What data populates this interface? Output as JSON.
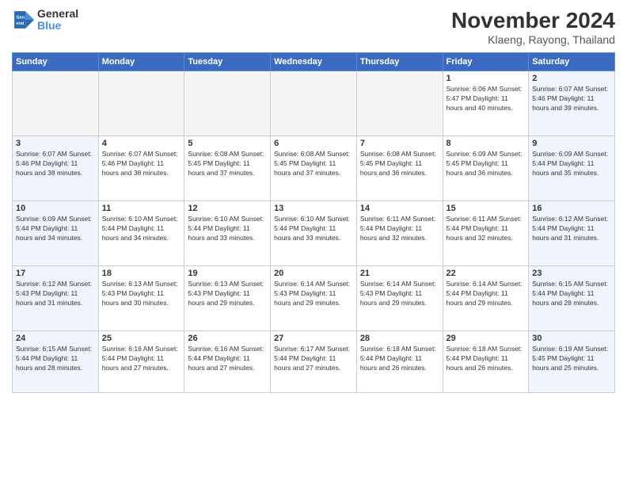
{
  "logo": {
    "line1": "General",
    "line2": "Blue"
  },
  "title": "November 2024",
  "location": "Klaeng, Rayong, Thailand",
  "weekdays": [
    "Sunday",
    "Monday",
    "Tuesday",
    "Wednesday",
    "Thursday",
    "Friday",
    "Saturday"
  ],
  "weeks": [
    [
      {
        "day": "",
        "info": ""
      },
      {
        "day": "",
        "info": ""
      },
      {
        "day": "",
        "info": ""
      },
      {
        "day": "",
        "info": ""
      },
      {
        "day": "",
        "info": ""
      },
      {
        "day": "1",
        "info": "Sunrise: 6:06 AM\nSunset: 5:47 PM\nDaylight: 11 hours\nand 40 minutes."
      },
      {
        "day": "2",
        "info": "Sunrise: 6:07 AM\nSunset: 5:46 PM\nDaylight: 11 hours\nand 39 minutes."
      }
    ],
    [
      {
        "day": "3",
        "info": "Sunrise: 6:07 AM\nSunset: 5:46 PM\nDaylight: 11 hours\nand 38 minutes."
      },
      {
        "day": "4",
        "info": "Sunrise: 6:07 AM\nSunset: 5:46 PM\nDaylight: 11 hours\nand 38 minutes."
      },
      {
        "day": "5",
        "info": "Sunrise: 6:08 AM\nSunset: 5:45 PM\nDaylight: 11 hours\nand 37 minutes."
      },
      {
        "day": "6",
        "info": "Sunrise: 6:08 AM\nSunset: 5:45 PM\nDaylight: 11 hours\nand 37 minutes."
      },
      {
        "day": "7",
        "info": "Sunrise: 6:08 AM\nSunset: 5:45 PM\nDaylight: 11 hours\nand 36 minutes."
      },
      {
        "day": "8",
        "info": "Sunrise: 6:09 AM\nSunset: 5:45 PM\nDaylight: 11 hours\nand 36 minutes."
      },
      {
        "day": "9",
        "info": "Sunrise: 6:09 AM\nSunset: 5:44 PM\nDaylight: 11 hours\nand 35 minutes."
      }
    ],
    [
      {
        "day": "10",
        "info": "Sunrise: 6:09 AM\nSunset: 5:44 PM\nDaylight: 11 hours\nand 34 minutes."
      },
      {
        "day": "11",
        "info": "Sunrise: 6:10 AM\nSunset: 5:44 PM\nDaylight: 11 hours\nand 34 minutes."
      },
      {
        "day": "12",
        "info": "Sunrise: 6:10 AM\nSunset: 5:44 PM\nDaylight: 11 hours\nand 33 minutes."
      },
      {
        "day": "13",
        "info": "Sunrise: 6:10 AM\nSunset: 5:44 PM\nDaylight: 11 hours\nand 33 minutes."
      },
      {
        "day": "14",
        "info": "Sunrise: 6:11 AM\nSunset: 5:44 PM\nDaylight: 11 hours\nand 32 minutes."
      },
      {
        "day": "15",
        "info": "Sunrise: 6:11 AM\nSunset: 5:44 PM\nDaylight: 11 hours\nand 32 minutes."
      },
      {
        "day": "16",
        "info": "Sunrise: 6:12 AM\nSunset: 5:44 PM\nDaylight: 11 hours\nand 31 minutes."
      }
    ],
    [
      {
        "day": "17",
        "info": "Sunrise: 6:12 AM\nSunset: 5:43 PM\nDaylight: 11 hours\nand 31 minutes."
      },
      {
        "day": "18",
        "info": "Sunrise: 6:13 AM\nSunset: 5:43 PM\nDaylight: 11 hours\nand 30 minutes."
      },
      {
        "day": "19",
        "info": "Sunrise: 6:13 AM\nSunset: 5:43 PM\nDaylight: 11 hours\nand 29 minutes."
      },
      {
        "day": "20",
        "info": "Sunrise: 6:14 AM\nSunset: 5:43 PM\nDaylight: 11 hours\nand 29 minutes."
      },
      {
        "day": "21",
        "info": "Sunrise: 6:14 AM\nSunset: 5:43 PM\nDaylight: 11 hours\nand 29 minutes."
      },
      {
        "day": "22",
        "info": "Sunrise: 6:14 AM\nSunset: 5:44 PM\nDaylight: 11 hours\nand 29 minutes."
      },
      {
        "day": "23",
        "info": "Sunrise: 6:15 AM\nSunset: 5:44 PM\nDaylight: 11 hours\nand 28 minutes."
      }
    ],
    [
      {
        "day": "24",
        "info": "Sunrise: 6:15 AM\nSunset: 5:44 PM\nDaylight: 11 hours\nand 28 minutes."
      },
      {
        "day": "25",
        "info": "Sunrise: 6:16 AM\nSunset: 5:44 PM\nDaylight: 11 hours\nand 27 minutes."
      },
      {
        "day": "26",
        "info": "Sunrise: 6:16 AM\nSunset: 5:44 PM\nDaylight: 11 hours\nand 27 minutes."
      },
      {
        "day": "27",
        "info": "Sunrise: 6:17 AM\nSunset: 5:44 PM\nDaylight: 11 hours\nand 27 minutes."
      },
      {
        "day": "28",
        "info": "Sunrise: 6:18 AM\nSunset: 5:44 PM\nDaylight: 11 hours\nand 26 minutes."
      },
      {
        "day": "29",
        "info": "Sunrise: 6:18 AM\nSunset: 5:44 PM\nDaylight: 11 hours\nand 26 minutes."
      },
      {
        "day": "30",
        "info": "Sunrise: 6:19 AM\nSunset: 5:45 PM\nDaylight: 11 hours\nand 25 minutes."
      }
    ]
  ]
}
